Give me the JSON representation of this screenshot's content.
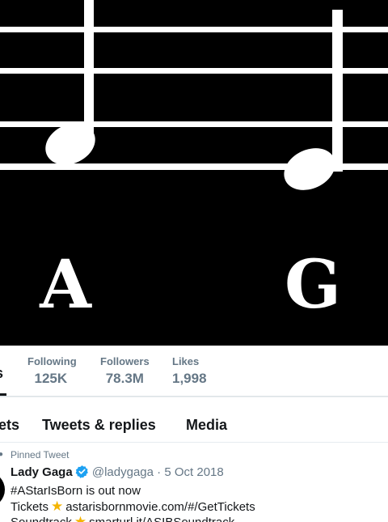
{
  "banner": {
    "note_letters": [
      "A",
      "G"
    ]
  },
  "stats": {
    "tweets_cut_label": "s",
    "items": [
      {
        "label": "Following",
        "value": "125K"
      },
      {
        "label": "Followers",
        "value": "78.3M"
      },
      {
        "label": "Likes",
        "value": "1,998"
      }
    ]
  },
  "tabs": [
    {
      "label": "ets"
    },
    {
      "label": "Tweets & replies"
    },
    {
      "label": "Media"
    }
  ],
  "tweet": {
    "pinned_label": "Pinned Tweet",
    "author_name": "Lady Gaga",
    "author_handle": "@ladygaga",
    "separator": "·",
    "date": "5 Oct 2018",
    "line1": "#AStarIsBorn is out now",
    "line2_prefix": "Tickets",
    "line2_link": "astarisbornmovie.com/#/GetTickets",
    "line3_prefix": "Soundtrack",
    "line3_link": "smarturl.it/ASIBSoundtrack"
  },
  "colors": {
    "banner_bg": "#000000",
    "muted_text": "#657786",
    "primary_text": "#14171a",
    "verified_blue": "#1da1f2",
    "star_gold": "#f4b400"
  }
}
